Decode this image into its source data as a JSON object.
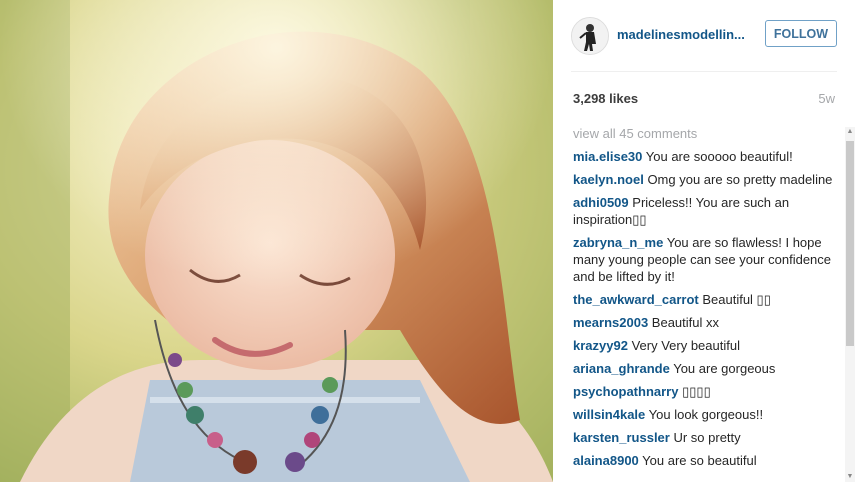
{
  "post": {
    "photo_description_icon": "portrait-photo",
    "avatar_icon": "profile-avatar"
  },
  "header": {
    "username": "madelinesmodellin...",
    "follow_label": "FOLLOW"
  },
  "stats": {
    "likes": "3,298 likes",
    "age": "5w"
  },
  "comments": {
    "view_all": "view all 45 comments",
    "items": [
      {
        "user": "mia.elise30",
        "text": "You are sooooo beautiful!"
      },
      {
        "user": "kaelyn.noel",
        "text": "Omg you are so pretty madeline"
      },
      {
        "user": "adhi0509",
        "text": "Priceless!! You are such an inspiration▯▯"
      },
      {
        "user": "zabryna_n_me",
        "text": "You are so flawless! I hope many young people can see your confidence and be lifted by it!"
      },
      {
        "user": "the_awkward_carrot",
        "text": "Beautiful ▯▯"
      },
      {
        "user": "mearns2003",
        "text": "Beautiful xx"
      },
      {
        "user": "krazyy92",
        "text": "Very Very beautiful"
      },
      {
        "user": "ariana_ghrande",
        "text": "You are gorgeous"
      },
      {
        "user": "psychopathnarry",
        "text": "▯▯▯▯"
      },
      {
        "user": "willsin4kale",
        "text": "You look gorgeous!!"
      },
      {
        "user": "karsten_russler",
        "text": "Ur so pretty"
      },
      {
        "user": "alaina8900",
        "text": "You are so beautiful"
      }
    ]
  },
  "colors": {
    "username": "#125688",
    "follow_border": "#70a1c7",
    "muted": "#a5a7aa"
  }
}
